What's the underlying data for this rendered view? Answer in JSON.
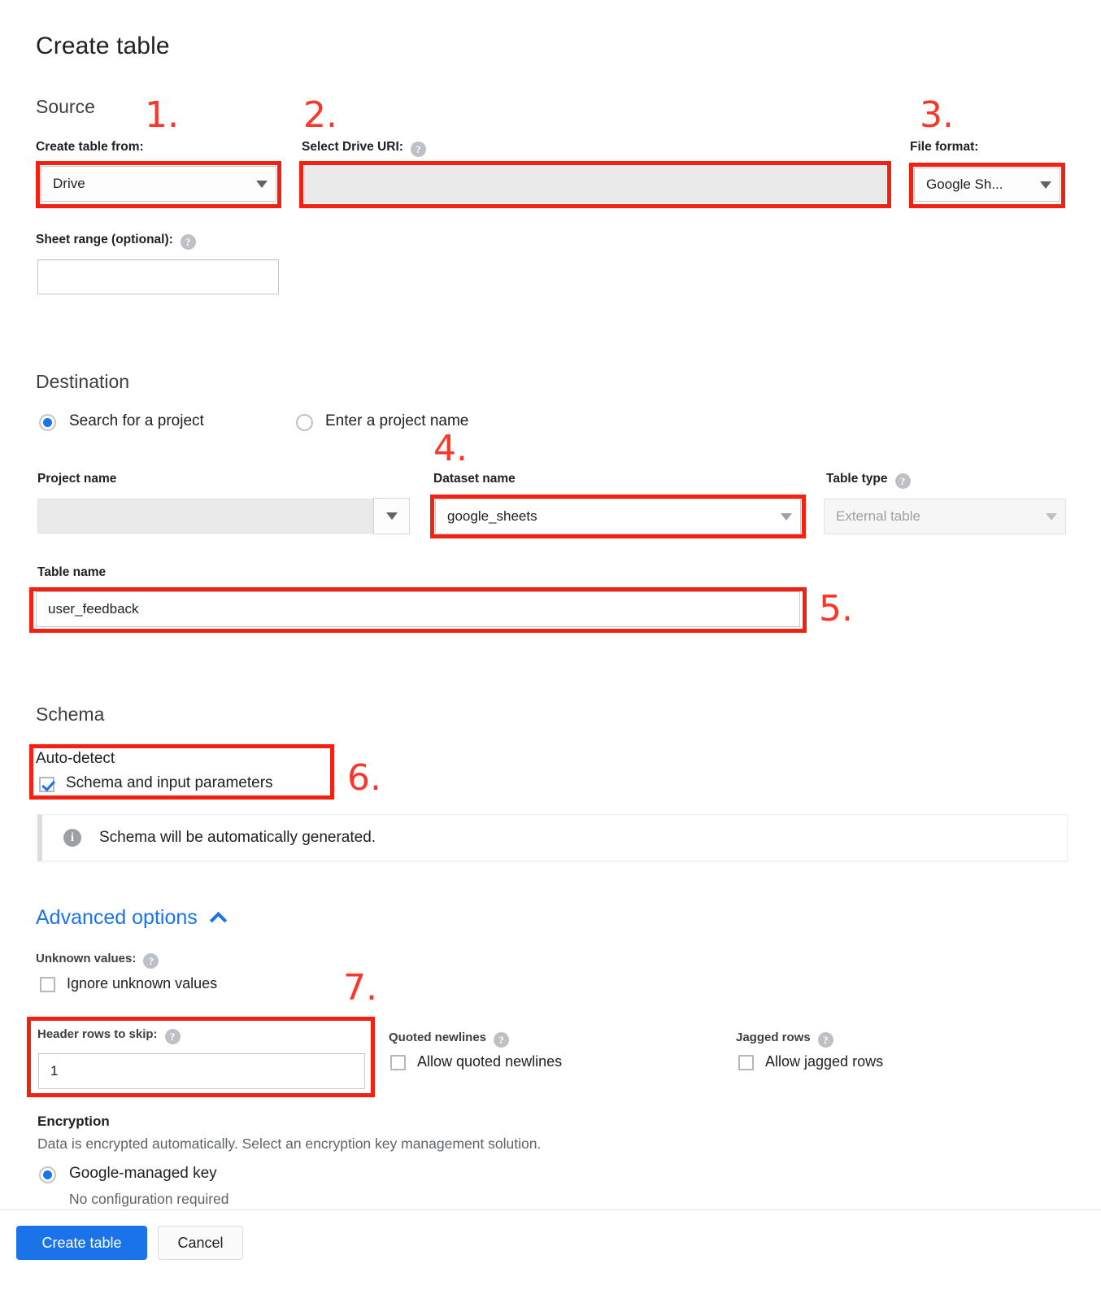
{
  "dialog": {
    "title": "Create table"
  },
  "source": {
    "heading": "Source",
    "create_from": {
      "label": "Create table from:",
      "value": "Drive"
    },
    "drive_uri": {
      "label": "Select Drive URI:",
      "value": "",
      "help_icon": "help-icon"
    },
    "file_format": {
      "label": "File format:",
      "value": "Google Sh..."
    },
    "sheet_range": {
      "label": "Sheet range (optional):",
      "value": "",
      "help_icon": "help-icon"
    }
  },
  "destination": {
    "heading": "Destination",
    "radio_search_project": "Search for a project",
    "radio_enter_project": "Enter a project name",
    "project_name": {
      "label": "Project name",
      "value": ""
    },
    "dataset_name": {
      "label": "Dataset name",
      "value": "google_sheets"
    },
    "table_type": {
      "label": "Table type",
      "value": "External table",
      "help_icon": "help-icon"
    },
    "table_name": {
      "label": "Table name",
      "value": "user_feedback"
    }
  },
  "schema": {
    "heading": "Schema",
    "auto_detect_label": "Auto-detect",
    "auto_detect_checkbox": "Schema and input parameters",
    "auto_detect_checked": true,
    "info_text": "Schema will be automatically generated.",
    "info_icon": "info-icon"
  },
  "advanced": {
    "link_label": "Advanced options",
    "chevron_icon": "chevron-up-icon",
    "unknown_values": {
      "label": "Unknown values:",
      "checkbox": "Ignore unknown values",
      "checked": false
    },
    "header_rows": {
      "label": "Header rows to skip:",
      "value": "1"
    },
    "quoted_newlines": {
      "label": "Quoted newlines",
      "checkbox": "Allow quoted newlines",
      "checked": false
    },
    "jagged_rows": {
      "label": "Jagged rows",
      "checkbox": "Allow jagged rows",
      "checked": false
    }
  },
  "encryption": {
    "heading": "Encryption",
    "description": "Data is encrypted automatically. Select an encryption key management solution.",
    "option_label": "Google-managed key",
    "option_sub": "No configuration required"
  },
  "footer": {
    "create_label": "Create table",
    "cancel_label": "Cancel"
  },
  "annotations": {
    "n1": "1.",
    "n2": "2.",
    "n3": "3.",
    "n4": "4.",
    "n5": "5.",
    "n6": "6.",
    "n7": "7."
  },
  "colors": {
    "accent": "#1a73e8",
    "annotation_red": "#f9372a",
    "text": "#202124",
    "muted": "#5f6368"
  }
}
